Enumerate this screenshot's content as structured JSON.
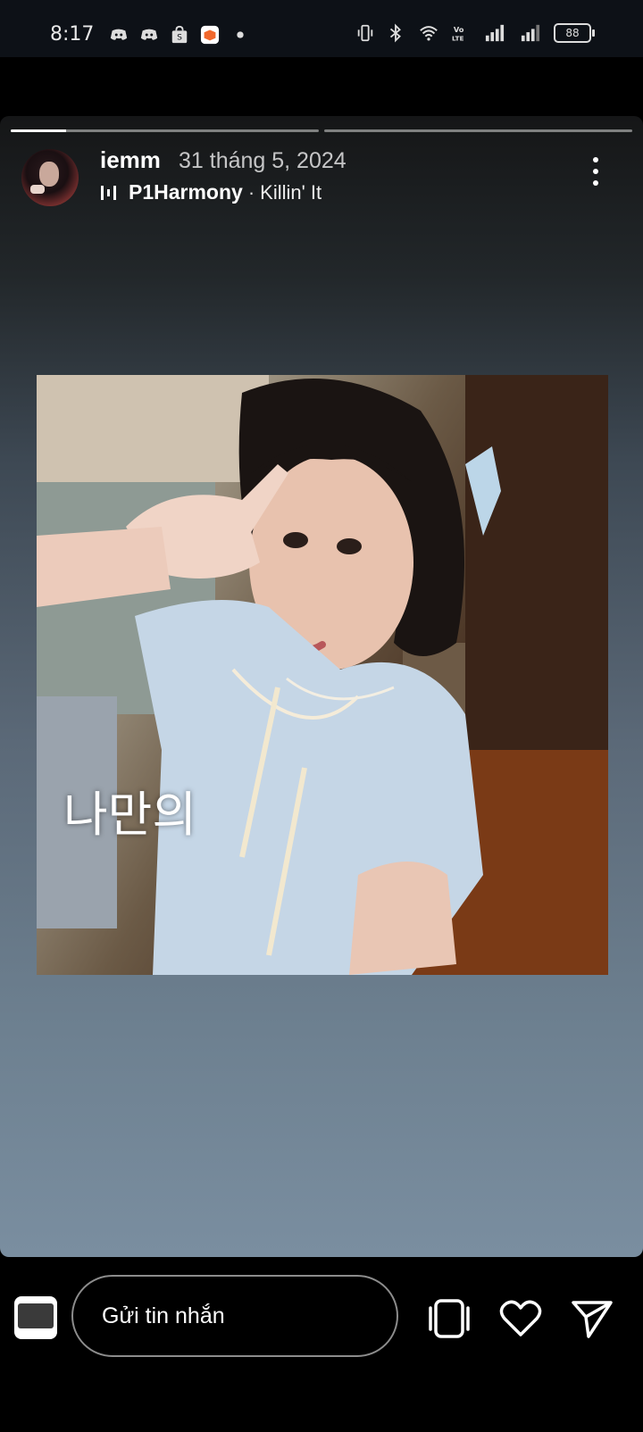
{
  "status_bar": {
    "time": "8:17",
    "battery": "88",
    "network": "VoLTE",
    "left_icons": [
      "discord-icon",
      "discord-icon",
      "shopee-icon",
      "game-app-icon",
      "dot-icon"
    ],
    "right_icons": [
      "vibrate-icon",
      "bluetooth-icon",
      "wifi-icon",
      "volte-icon",
      "signal-icon",
      "signal-icon",
      "battery-icon"
    ]
  },
  "story": {
    "progress": [
      0.18,
      0.0
    ],
    "username": "iemm",
    "date": "31 tháng 5, 2024",
    "music": {
      "artist": "P1Harmony",
      "separator": "·",
      "song": "Killin' It"
    },
    "photo_overlay_text": "나만의"
  },
  "reply_bar": {
    "input_placeholder": "Gửi tin nhắn",
    "actions": [
      "stickers-icon",
      "heart-icon",
      "send-icon"
    ]
  },
  "colors": {
    "background": "#000000",
    "accent": "#ffffff"
  }
}
